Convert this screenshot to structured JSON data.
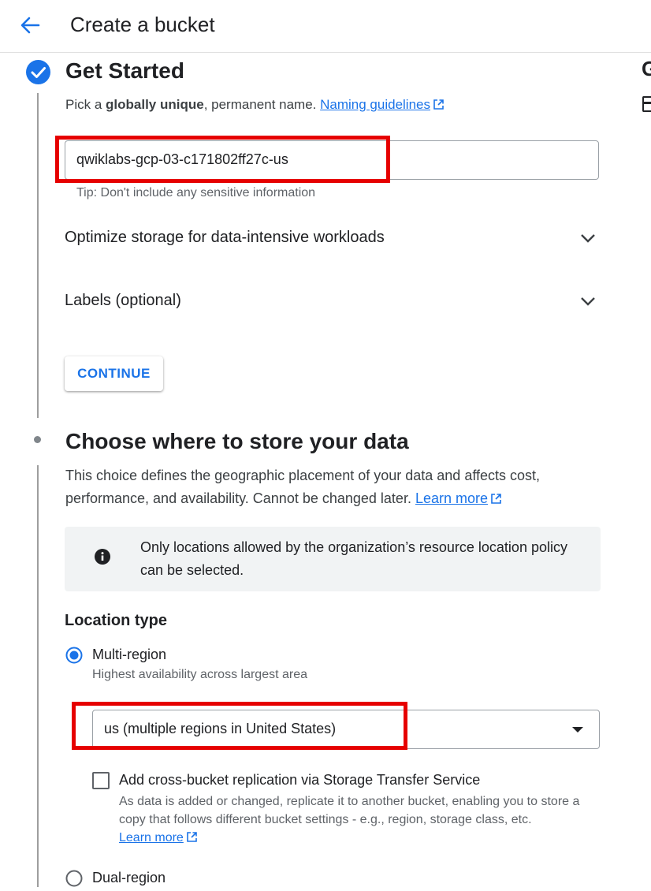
{
  "header": {
    "title": "Create a bucket",
    "right_fragment_letter": "G"
  },
  "step_get_started": {
    "title": "Get Started",
    "desc_prefix": "Pick a ",
    "desc_bold": "globally unique",
    "desc_suffix": ", permanent name. ",
    "naming_link": "Naming guidelines",
    "name_value": "qwiklabs-gcp-03-c171802ff27c-us",
    "tip": "Tip: Don't include any sensitive information",
    "optimize_label": "Optimize storage for data-intensive workloads",
    "labels_label": "Labels (optional)",
    "continue_label": "CONTINUE"
  },
  "step_location": {
    "title": "Choose where to store your data",
    "desc": "This choice defines the geographic placement of your data and affects cost, performance, and availability. Cannot be changed later. ",
    "learn_more": "Learn more",
    "info_text": "Only locations allowed by the organization’s resource location policy can be selected.",
    "location_type_label": "Location type",
    "multi_region_label": "Multi-region",
    "multi_region_desc": "Highest availability across largest area",
    "location_select_value": "us (multiple regions in United States)",
    "replication_label": "Add cross-bucket replication via Storage Transfer Service",
    "replication_desc": "As data is added or changed, replicate it to another bucket, enabling you to store a copy that follows different bucket settings - e.g., region, storage class, etc.",
    "replication_learn_more": "Learn more",
    "dual_region_label": "Dual-region"
  },
  "colors": {
    "accent": "#1a73e8",
    "highlight_box": "#e60000",
    "info_background": "#f1f3f4"
  }
}
